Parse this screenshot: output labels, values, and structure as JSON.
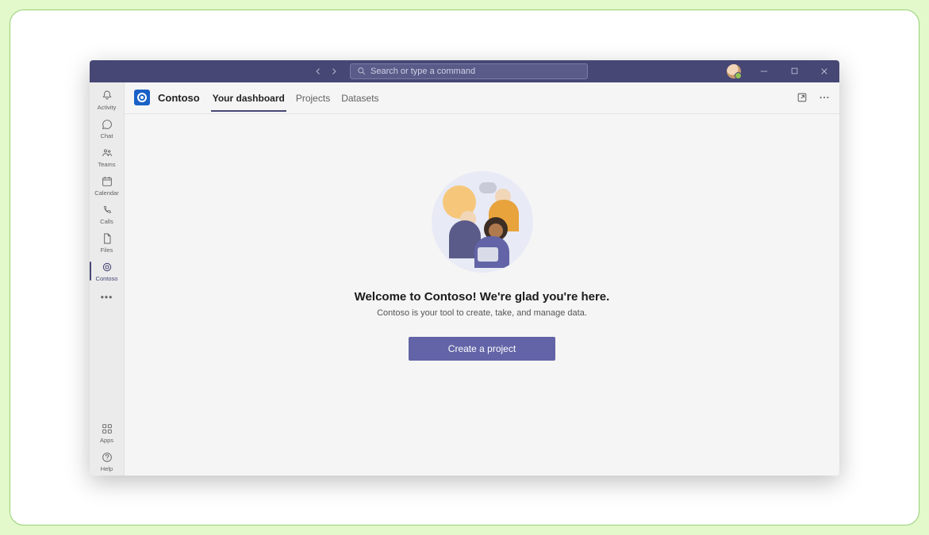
{
  "titlebar": {
    "search_placeholder": "Search or type a command"
  },
  "rail": {
    "items": [
      {
        "id": "activity",
        "label": "Activity"
      },
      {
        "id": "chat",
        "label": "Chat"
      },
      {
        "id": "teams",
        "label": "Teams"
      },
      {
        "id": "calendar",
        "label": "Calendar"
      },
      {
        "id": "calls",
        "label": "Calls"
      },
      {
        "id": "files",
        "label": "Files"
      },
      {
        "id": "contoso",
        "label": "Contoso"
      }
    ],
    "bottom": [
      {
        "id": "apps",
        "label": "Apps"
      },
      {
        "id": "help",
        "label": "Help"
      }
    ]
  },
  "header": {
    "app_name": "Contoso",
    "tabs": [
      {
        "id": "dashboard",
        "label": "Your dashboard",
        "active": true
      },
      {
        "id": "projects",
        "label": "Projects"
      },
      {
        "id": "datasets",
        "label": "Datasets"
      }
    ]
  },
  "hero": {
    "title": "Welcome to Contoso! We're glad you're here.",
    "subtitle": "Contoso is your tool to create, take, and manage data.",
    "cta_label": "Create a project"
  }
}
